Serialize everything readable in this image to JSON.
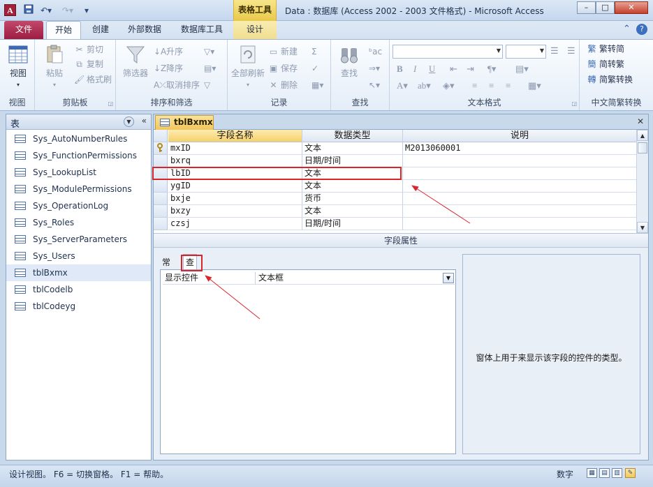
{
  "titlebar": {
    "contextual_group": "表格工具",
    "title": "Data : 数据库 (Access 2002 - 2003 文件格式) - Microsoft Access",
    "app_icon_letter": "A"
  },
  "ribbon_tabs": {
    "file": "文件",
    "home": "开始",
    "create": "创建",
    "external": "外部数据",
    "dbtools": "数据库工具",
    "design": "设计"
  },
  "ribbon": {
    "views": {
      "label": "视图",
      "view_btn": "视图"
    },
    "clipboard": {
      "label": "剪贴板",
      "paste": "粘贴",
      "cut": "剪切",
      "copy": "复制",
      "format_painter": "格式刷"
    },
    "sort_filter": {
      "label": "排序和筛选",
      "filter": "筛选器",
      "ascending": "升序",
      "descending": "降序",
      "remove_sort": "取消排序"
    },
    "records": {
      "label": "记录",
      "refresh_all": "全部刷新",
      "new": "新建",
      "save": "保存",
      "delete": "删除"
    },
    "find": {
      "label": "查找",
      "find_btn": "查找"
    },
    "text_format": {
      "label": "文本格式"
    },
    "chinese": {
      "label": "中文简繁转换",
      "to_simplified": "繁转简",
      "to_traditional": "简转繁",
      "convert": "简繁转换"
    }
  },
  "nav_pane": {
    "title": "表",
    "items": [
      {
        "label": "Sys_AutoNumberRules"
      },
      {
        "label": "Sys_FunctionPermissions"
      },
      {
        "label": "Sys_LookupList"
      },
      {
        "label": "Sys_ModulePermissions"
      },
      {
        "label": "Sys_OperationLog"
      },
      {
        "label": "Sys_Roles"
      },
      {
        "label": "Sys_ServerParameters"
      },
      {
        "label": "Sys_Users"
      },
      {
        "label": "tblBxmx"
      },
      {
        "label": "tblCodelb"
      },
      {
        "label": "tblCodeyg"
      }
    ],
    "selected_index": 8
  },
  "document": {
    "tab_label": "tblBxmx",
    "columns": {
      "field_name": "字段名称",
      "data_type": "数据类型",
      "description": "说明"
    },
    "rows": [
      {
        "name": "mxID",
        "type": "文本",
        "desc": "M2013060001",
        "primary_key": true
      },
      {
        "name": "bxrq",
        "type": "日期/时间",
        "desc": ""
      },
      {
        "name": "lbID",
        "type": "文本",
        "desc": ""
      },
      {
        "name": "ygID",
        "type": "文本",
        "desc": ""
      },
      {
        "name": "bxje",
        "type": "货币",
        "desc": ""
      },
      {
        "name": "bxzy",
        "type": "文本",
        "desc": ""
      },
      {
        "name": "czsj",
        "type": "日期/时间",
        "desc": ""
      }
    ],
    "highlighted_row_index": 2,
    "properties_bar": "字段属性",
    "prop_tabs": {
      "general": "常规",
      "lookup": "查阅"
    },
    "prop_rows": [
      {
        "label": "显示控件",
        "value": "文本框"
      }
    ],
    "hint": "窗体上用于来显示该字段的控件的类型。"
  },
  "statusbar": {
    "left": "设计视图。  F6 = 切换窗格。  F1 = 帮助。",
    "numlock": "数字"
  },
  "colors": {
    "file_tab": "#9c1d43",
    "annotation_red": "#d9242a",
    "active_tab_gold": "#f1c55a"
  }
}
